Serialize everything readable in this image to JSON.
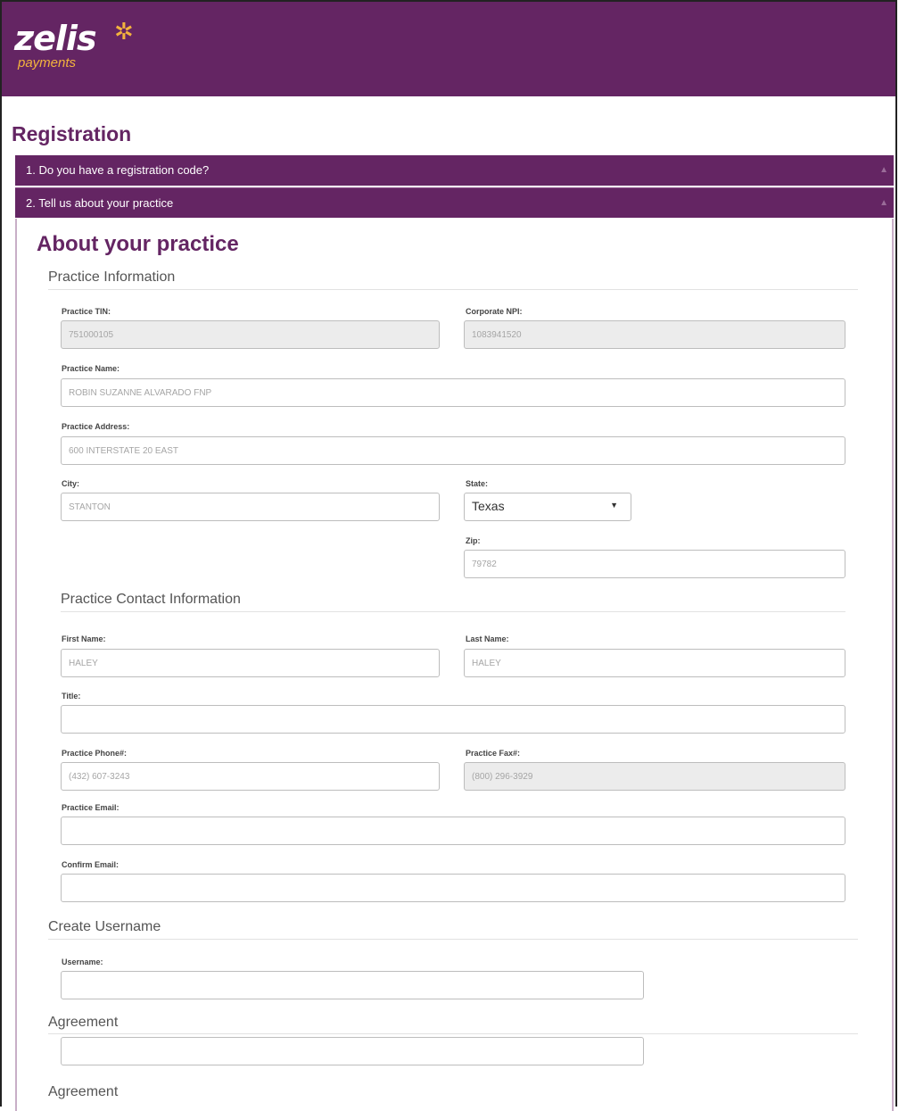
{
  "brand": {
    "name": "zelis",
    "sub": "payments",
    "star_glyph": "✲",
    "header_color": "#642563",
    "accent_color": "#f3b33d"
  },
  "page": {
    "title": "Registration"
  },
  "steps": [
    {
      "label": "1. Do you have a registration code?"
    },
    {
      "label": "2. Tell us about your practice"
    }
  ],
  "form": {
    "heading": "About your practice",
    "sections": {
      "practice_info": "Practice Information",
      "contact_info": "Practice Contact Information",
      "username": "Create Username",
      "agreement1": "Agreement",
      "agreement2": "Agreement"
    },
    "fields": {
      "tin": {
        "label": "Practice TIN:",
        "value": "751000105"
      },
      "npi": {
        "label": "Corporate NPI:",
        "value": "1083941520"
      },
      "name": {
        "label": "Practice Name:",
        "value": "ROBIN SUZANNE ALVARADO FNP"
      },
      "address": {
        "label": "Practice Address:",
        "value": "600 INTERSTATE 20 EAST"
      },
      "city": {
        "label": "City:",
        "value": "STANTON"
      },
      "state": {
        "label": "State:",
        "value": "Texas"
      },
      "zip": {
        "label": "Zip:",
        "value": "79782"
      },
      "first_name": {
        "label": "First Name:",
        "value": "HALEY"
      },
      "last_name": {
        "label": "Last Name:",
        "value": "HALEY"
      },
      "title": {
        "label": "Title:",
        "value": ""
      },
      "phone": {
        "label": "Practice Phone#:",
        "value": "(432) 607-3243"
      },
      "fax": {
        "label": "Practice Fax#:",
        "value": "(800) 296-3929"
      },
      "email": {
        "label": "Practice Email:",
        "value": ""
      },
      "confirm_email": {
        "label": "Confirm Email:",
        "value": ""
      },
      "username": {
        "label": "Username:",
        "value": ""
      },
      "agreement": {
        "value": ""
      }
    }
  },
  "icons": {
    "state_dropdown": "caret-down-icon",
    "accordion_collapse": "caret-up-icon"
  }
}
